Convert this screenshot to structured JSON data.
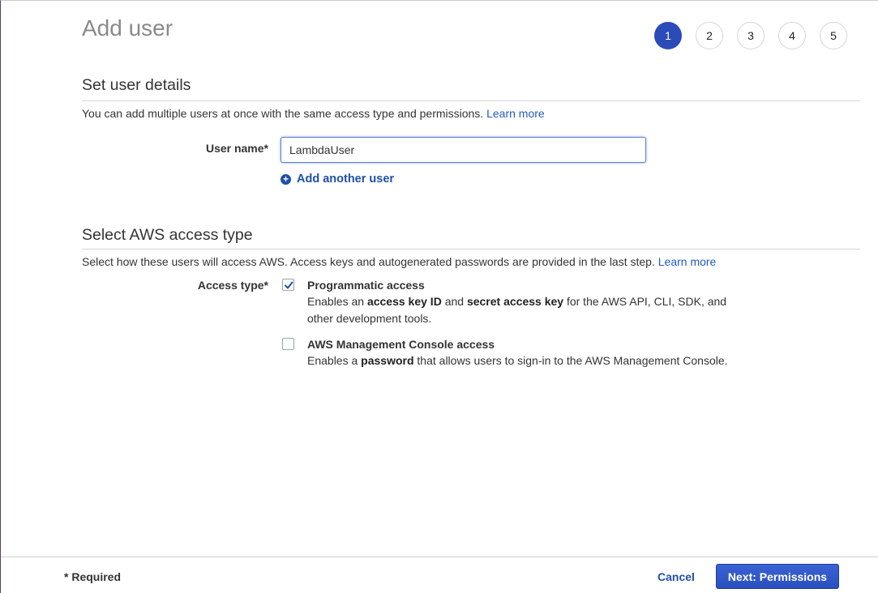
{
  "header": {
    "title": "Add user",
    "steps": [
      "1",
      "2",
      "3",
      "4",
      "5"
    ],
    "active_step": "1"
  },
  "user_details": {
    "section_title": "Set user details",
    "description": "You can add multiple users at once with the same access type and permissions.",
    "learn_more": "Learn more",
    "user_name_label": "User name*",
    "user_name_value": "LambdaUser",
    "add_another_user": "Add another user"
  },
  "access_type": {
    "section_title": "Select AWS access type",
    "description": "Select how these users will access AWS. Access keys and autogenerated passwords are provided in the last step.",
    "learn_more": "Learn more",
    "label": "Access type*",
    "options": [
      {
        "title": "Programmatic access",
        "checked": true,
        "desc_parts": [
          "Enables an ",
          "access key ID",
          " and ",
          "secret access key",
          " for the AWS API, CLI, SDK, and other development tools."
        ]
      },
      {
        "title": "AWS Management Console access",
        "checked": false,
        "desc_parts": [
          "Enables a ",
          "password",
          " that allows users to sign-in to the AWS Management Console."
        ]
      }
    ]
  },
  "footer": {
    "required_note": "* Required",
    "cancel_label": "Cancel",
    "next_label": "Next: Permissions"
  },
  "colors": {
    "accent": "#2a4bb8",
    "link": "#1f5bbf",
    "check": "#1f4fa8"
  },
  "icons": {
    "add": "plus-circle-icon",
    "check": "checkmark-icon"
  }
}
